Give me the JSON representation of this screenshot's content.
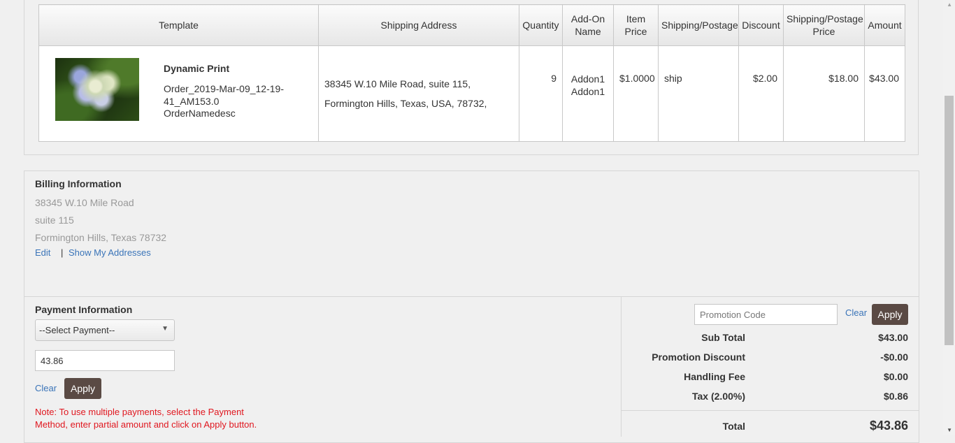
{
  "order_table": {
    "headers": {
      "template": "Template",
      "shipping_address": "Shipping Address",
      "quantity": "Quantity",
      "addon_name": "Add-On Name",
      "item_price": "Item Price",
      "shipping_postage": "Shipping/Postage",
      "discount": "Discount",
      "shipping_postage_price": "Shipping/Postage Price",
      "amount": "Amount"
    },
    "row": {
      "template_name": "Dynamic Print",
      "order_name": "Order_2019-Mar-09_12-19-41_AM153.0",
      "order_desc": "OrderNamedesc",
      "address_line1": "38345 W.10 Mile Road, suite 115,",
      "address_line2": "Formington Hills, Texas, USA, 78732,",
      "quantity": "9",
      "addon1": "Addon1",
      "addon2": "Addon1",
      "item_price": "$1.0000",
      "shipping": "ship",
      "discount": "$2.00",
      "shipping_price": "$18.00",
      "amount": "$43.00"
    }
  },
  "billing": {
    "title": "Billing Information",
    "line1": "38345 W.10 Mile Road",
    "line2": "suite 115",
    "line3": "Formington Hills, Texas 78732",
    "edit_label": "Edit",
    "separator": "|",
    "show_addresses_label": "Show My Addresses"
  },
  "payment": {
    "title": "Payment Information",
    "select_value": "--Select Payment--",
    "amount_value": "43.86",
    "clear_label": "Clear",
    "apply_label": "Apply",
    "note": "Note: To use multiple payments, select the Payment Method, enter partial amount and click on Apply button."
  },
  "summary": {
    "promo_placeholder": "Promotion Code",
    "clear_label": "Clear",
    "apply_label": "Apply",
    "subtotal_label": "Sub Total",
    "subtotal_value": "$43.00",
    "promo_discount_label": "Promotion Discount",
    "promo_discount_value": "-$0.00",
    "handling_label": "Handling Fee",
    "handling_value": "$0.00",
    "tax_label": "Tax (2.00%)",
    "tax_value": "$0.86",
    "total_label": "Total",
    "total_value": "$43.86"
  },
  "colors": {
    "link": "#3a74b8",
    "button": "#5a4a44",
    "note": "#e0171f"
  }
}
